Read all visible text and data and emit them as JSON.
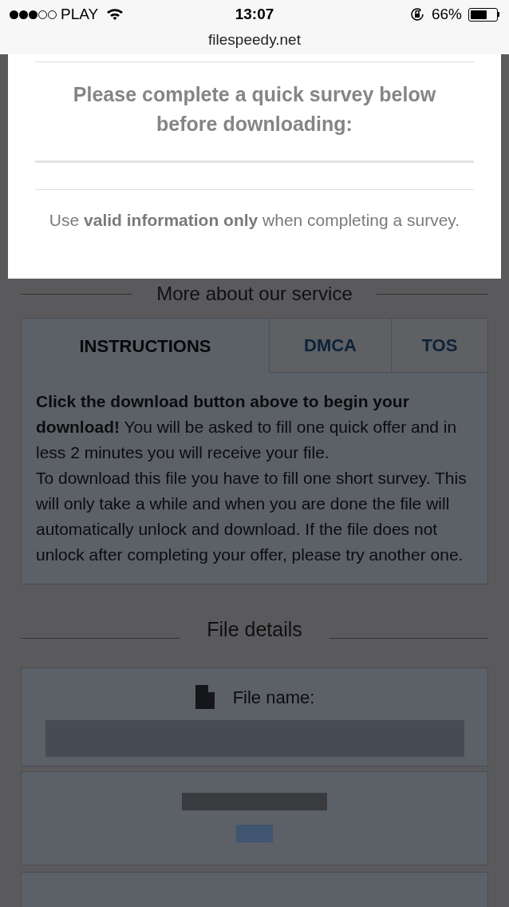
{
  "status_bar": {
    "carrier": "PLAY",
    "time": "13:07",
    "battery": "66%"
  },
  "address_bar": {
    "url": "filespeedy.net"
  },
  "modal": {
    "heading": "Please complete a quick survey below before downloading:",
    "note": "Use **valid information only** when completing a survey."
  },
  "service_heading": "More about our service",
  "tabs": [
    {
      "label": "INSTRUCTIONS",
      "selected": true
    },
    {
      "label": "DMCA",
      "selected": false
    },
    {
      "label": "TOS",
      "selected": false
    }
  ],
  "instructions": "**Click the download button above to begin your download!** You will be asked to fill one quick offer and in less 2 minutes you will receive your file.\nTo download this file you have to fill one short survey. This will only take a while and when you are done the file will automatically unlock and download. If the file does not unlock after completing your offer, please try another one.",
  "file_details": {
    "heading": "File details",
    "file_name_label": "File name:"
  }
}
